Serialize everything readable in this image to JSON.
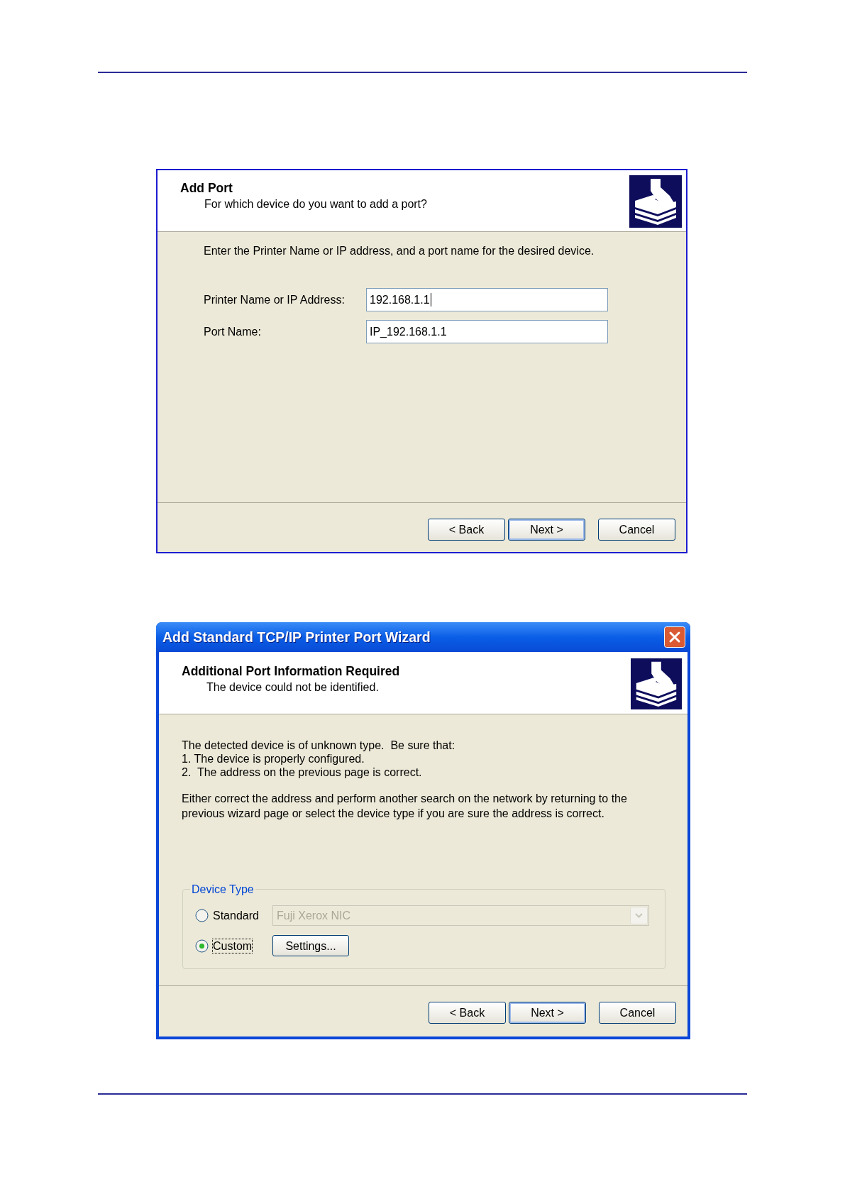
{
  "add_port_dialog": {
    "header": {
      "title": "Add Port",
      "subtitle": "For which device do you want to add a port?"
    },
    "instruction": "Enter the Printer Name or IP address, and a port name for the desired device.",
    "fields": [
      {
        "label": "Printer Name or IP Address:",
        "value": "192.168.1.1",
        "focused": true
      },
      {
        "label": "Port Name:",
        "value": "IP_192.168.1.1",
        "focused": false
      }
    ],
    "buttons": [
      {
        "label": "< Back",
        "default": false
      },
      {
        "label": "Next >",
        "default": true
      },
      {
        "label": "Cancel",
        "default": false
      }
    ]
  },
  "wizard_dialog": {
    "title_bar": {
      "title": "Add Standard TCP/IP Printer Port Wizard"
    },
    "header": {
      "title": "Additional Port Information Required",
      "subtitle": "The device could not be identified."
    },
    "message_lines": [
      "The detected device is of unknown type.  Be sure that:",
      "1. The device is properly configured.",
      "2.  The address on the previous page is correct."
    ],
    "paragraph": "Either correct the address and perform another search on the network by returning to the previous wizard page or select the device type if you are sure the address is correct.",
    "device_type": {
      "legend": "Device Type",
      "options": [
        {
          "label": "Standard",
          "selected": false,
          "focused": false,
          "control": {
            "kind": "dropdown",
            "value": "Fuji Xerox NIC",
            "disabled": true
          }
        },
        {
          "label": "Custom",
          "selected": true,
          "focused": true,
          "control": {
            "kind": "button",
            "label": "Settings..."
          }
        }
      ]
    },
    "buttons": [
      {
        "label": "< Back",
        "default": false
      },
      {
        "label": "Next >",
        "default": true
      },
      {
        "label": "Cancel",
        "default": false
      }
    ]
  }
}
